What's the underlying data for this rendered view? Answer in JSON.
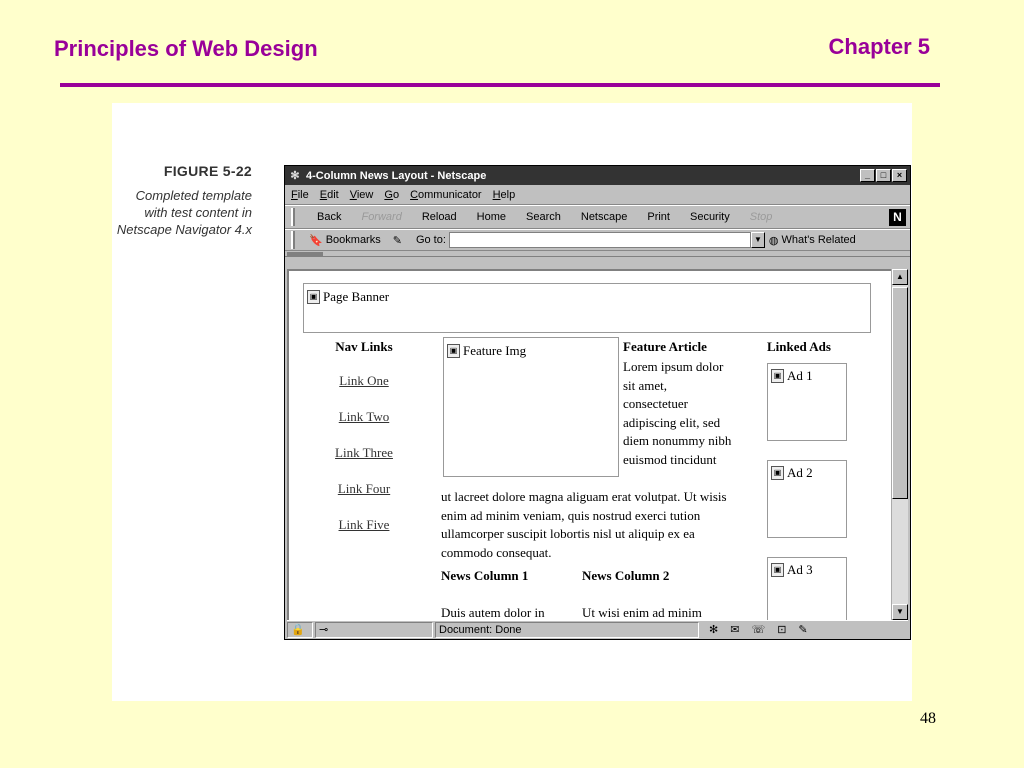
{
  "slide": {
    "title": "Principles of Web Design",
    "chapter": "Chapter 5",
    "page_number": "48",
    "title_color": "#990099"
  },
  "figure": {
    "number": "FIGURE 5-22",
    "caption": "Completed template with test content in Netscape Navigator 4.x"
  },
  "window": {
    "title": "4-Column News Layout - Netscape",
    "controls": [
      "_",
      "□",
      "×"
    ]
  },
  "menu": [
    "File",
    "Edit",
    "View",
    "Go",
    "Communicator",
    "Help"
  ],
  "toolbar": {
    "buttons": [
      {
        "label": "Back",
        "enabled": true
      },
      {
        "label": "Forward",
        "enabled": false
      },
      {
        "label": "Reload",
        "enabled": true
      },
      {
        "label": "Home",
        "enabled": true
      },
      {
        "label": "Search",
        "enabled": true
      },
      {
        "label": "Netscape",
        "enabled": true
      },
      {
        "label": "Print",
        "enabled": true
      },
      {
        "label": "Security",
        "enabled": true
      },
      {
        "label": "Stop",
        "enabled": false
      }
    ],
    "logo": "N"
  },
  "location": {
    "bookmarks_label": "Bookmarks",
    "goto_label": "Go to:",
    "url_value": "",
    "related_label": "What's Related"
  },
  "page": {
    "banner": "Page Banner",
    "nav": {
      "heading": "Nav Links",
      "links": [
        "Link One",
        "Link Two",
        "Link Three",
        "Link Four",
        "Link Five"
      ]
    },
    "feature": {
      "image": "Feature Img",
      "heading": "Feature Article",
      "body_top": "Lorem ipsum dolor sit amet, consectetuer adipiscing elit, sed diem nonummy nibh euismod tincidunt",
      "body_bottom": "ut lacreet dolore magna aliguam erat volutpat. Ut wisis enim ad minim veniam, quis nostrud exerci tution ullamcorper suscipit lobortis nisl ut aliquip ex ea commodo consequat."
    },
    "ads": {
      "heading": "Linked Ads",
      "items": [
        "Ad 1",
        "Ad 2",
        "Ad 3"
      ]
    },
    "news": [
      {
        "heading": "News Column 1",
        "body": "Duis autem dolor in"
      },
      {
        "heading": "News Column 2",
        "body": "Ut wisi enim ad minim"
      }
    ]
  },
  "status": {
    "text": "Document: Done"
  }
}
